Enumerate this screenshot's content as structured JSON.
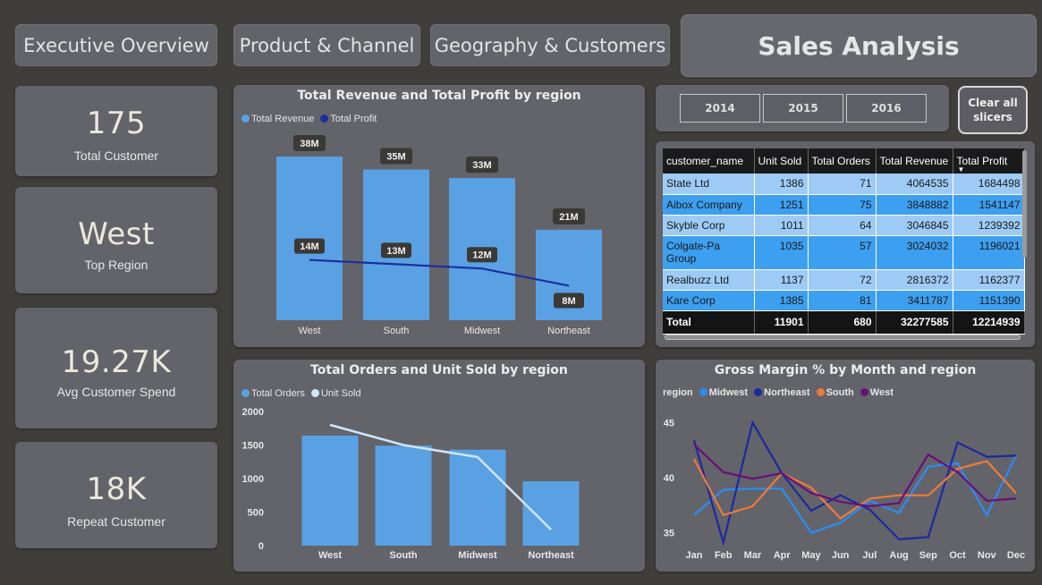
{
  "nav": {
    "executive": "Executive Overview",
    "product": "Product & Channel",
    "geography": "Geography & Customers"
  },
  "page_title": "Sales Analysis",
  "kpis": [
    {
      "value": "175",
      "label": "Total Customer"
    },
    {
      "value": "West",
      "label": "Top Region"
    },
    {
      "value": "19.27K",
      "label": "Avg Customer Spend"
    },
    {
      "value": "18K",
      "label": "Repeat Customer"
    }
  ],
  "slicer": {
    "years": [
      "2014",
      "2015",
      "2016"
    ],
    "clear_label_1": "Clear all",
    "clear_label_2": "slicers"
  },
  "table": {
    "headers": [
      "customer_name",
      "Unit Sold",
      "Total Orders",
      "Total Revenue",
      "Total Profit"
    ],
    "rows": [
      {
        "name": "State Ltd",
        "name2": "",
        "unit": "1386",
        "orders": "71",
        "revenue": "4064535",
        "profit": "1684498"
      },
      {
        "name": "Aibox Company",
        "name2": "",
        "unit": "1251",
        "orders": "75",
        "revenue": "3848882",
        "profit": "1541147"
      },
      {
        "name": "Skyble Corp",
        "name2": "",
        "unit": "1011",
        "orders": "64",
        "revenue": "3046845",
        "profit": "1239392"
      },
      {
        "name": "Colgate-Pa",
        "name2": "Group",
        "unit": "1035",
        "orders": "57",
        "revenue": "3024032",
        "profit": "1196021"
      },
      {
        "name": "Realbuzz Ltd",
        "name2": "",
        "unit": "1137",
        "orders": "72",
        "revenue": "2816372",
        "profit": "1162377"
      },
      {
        "name": "Kare Corp",
        "name2": "",
        "unit": "1385",
        "orders": "81",
        "revenue": "3411787",
        "profit": "1151390"
      }
    ],
    "total": {
      "name": "Total",
      "unit": "11901",
      "orders": "680",
      "revenue": "32277585",
      "profit": "12214939"
    }
  },
  "colors": {
    "bar": "#5aa1e3",
    "profit_line": "#1a2ea0",
    "unit_line": "#cfe6fb",
    "midwest": "#2a8cf5",
    "northeast": "#1b2a9e",
    "south": "#ee7a3a",
    "west": "#6a0f7a"
  },
  "chart_data": [
    {
      "type": "bar",
      "title": "Total Revenue and Total Profit by region",
      "categories": [
        "West",
        "South",
        "Midwest",
        "Northeast"
      ],
      "series": [
        {
          "name": "Total Revenue",
          "values": [
            38,
            35,
            33,
            21
          ],
          "labels": [
            "38M",
            "35M",
            "33M",
            "21M"
          ],
          "render": "bar"
        },
        {
          "name": "Total Profit",
          "values": [
            14,
            13,
            12,
            8
          ],
          "labels": [
            "14M",
            "13M",
            "12M",
            "8M"
          ],
          "render": "line"
        }
      ],
      "legend": "top-left"
    },
    {
      "type": "bar",
      "title": "Total Orders and Unit Sold by region",
      "categories": [
        "West",
        "South",
        "Midwest",
        "Northeast"
      ],
      "yticks": [
        "2000",
        "1500",
        "1000",
        "500",
        "0"
      ],
      "ylim": [
        0,
        2000
      ],
      "series": [
        {
          "name": "Total Orders",
          "values": [
            1640,
            1490,
            1430,
            960
          ],
          "render": "bar"
        },
        {
          "name": "Unit Sold",
          "values": [
            1800,
            1500,
            1320,
            240
          ],
          "render": "line"
        }
      ],
      "legend": "top-left"
    },
    {
      "type": "line",
      "title": "Gross Margin % by Month and region",
      "legend_title": "region",
      "categories": [
        "Jan",
        "Feb",
        "Mar",
        "Apr",
        "May",
        "Jun",
        "Jul",
        "Aug",
        "Sep",
        "Oct",
        "Nov",
        "Dec"
      ],
      "yticks": [
        "45",
        "40",
        "35"
      ],
      "ylim": [
        33.5,
        46.5
      ],
      "series": [
        {
          "name": "Midwest",
          "values": [
            36.6,
            38.9,
            39.0,
            39.0,
            35.0,
            35.9,
            37.9,
            36.8,
            41.0,
            41.3,
            36.6,
            42.0
          ]
        },
        {
          "name": "Northeast",
          "values": [
            43.4,
            34.1,
            45.0,
            40.4,
            37.0,
            38.4,
            37.1,
            34.4,
            34.6,
            43.2,
            41.9,
            42.0
          ]
        },
        {
          "name": "South",
          "values": [
            41.7,
            36.6,
            37.4,
            40.4,
            39.1,
            36.3,
            38.1,
            38.4,
            38.4,
            40.8,
            41.5,
            38.6
          ]
        },
        {
          "name": "West",
          "values": [
            43.0,
            40.5,
            39.9,
            40.4,
            38.6,
            37.8,
            37.4,
            37.7,
            42.1,
            40.5,
            37.9,
            38.1
          ]
        }
      ],
      "legend": "top-left"
    }
  ]
}
